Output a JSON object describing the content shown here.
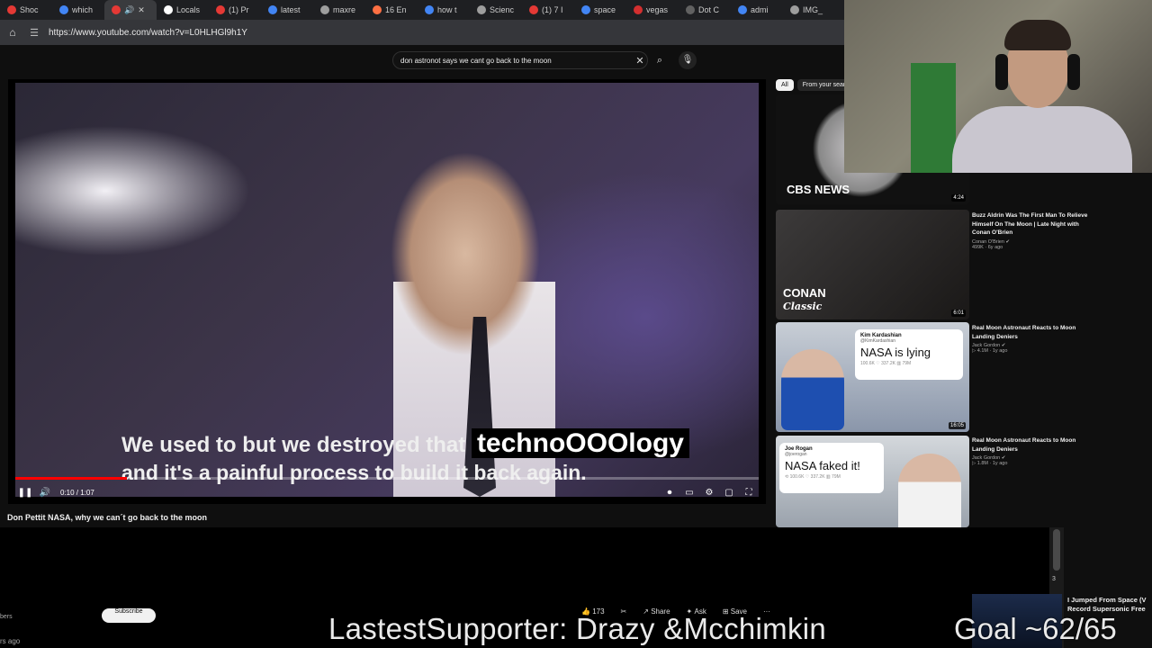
{
  "browser": {
    "tabs": [
      {
        "label": "Shoc",
        "favicon_color": "#e53935",
        "active": false
      },
      {
        "label": "which",
        "favicon_color": "#4285f4",
        "active": false
      },
      {
        "label": "",
        "favicon_color": "#e53935",
        "active": true
      },
      {
        "label": "Locals",
        "favicon_color": "#ffffff",
        "active": false
      },
      {
        "label": "(1) Pr",
        "favicon_color": "#e53935",
        "active": false
      },
      {
        "label": "latest",
        "favicon_color": "#4285f4",
        "active": false
      },
      {
        "label": "maxre",
        "favicon_color": "#9e9e9e",
        "active": false
      },
      {
        "label": "16 En",
        "favicon_color": "#ff7043",
        "active": false
      },
      {
        "label": "how t",
        "favicon_color": "#4285f4",
        "active": false
      },
      {
        "label": "Scienc",
        "favicon_color": "#9e9e9e",
        "active": false
      },
      {
        "label": "(1) 7 I",
        "favicon_color": "#e53935",
        "active": false
      },
      {
        "label": "space",
        "favicon_color": "#4285f4",
        "active": false
      },
      {
        "label": "vegas",
        "favicon_color": "#d32f2f",
        "active": false
      },
      {
        "label": "Dot C",
        "favicon_color": "#616161",
        "active": false
      },
      {
        "label": "admi",
        "favicon_color": "#4285f4",
        "active": false
      },
      {
        "label": "IMG_",
        "favicon_color": "#9e9e9e",
        "active": false
      }
    ],
    "url": "https://www.youtube.com/watch?v=L0HLHGl9h1Y"
  },
  "youtube": {
    "search_query": "don astronot says we cant go back to the moon",
    "player": {
      "subtitle_line1": "We used to but we destroyed that",
      "subtitle_highlight": "technoOOOlogy",
      "subtitle_line2": "and it's a painful process to build it back again.",
      "time": "0:10 / 1:07",
      "progress": 0.15
    },
    "video_title": "Don Pettit NASA, why we can´t go back to the moon",
    "chips": [
      "All",
      "From your sear"
    ],
    "recommended": [
      {
        "brand": "CBS NEWS",
        "duration": "4:24"
      },
      {
        "brand_line1": "CONAN",
        "brand_line2": "Classic",
        "duration": "6:01",
        "title": "Buzz Aldrin Was The First Man To Relieve Himself On The Moon | Late Night with Conan O'Brien",
        "channel": "Conan O'Brien ✔",
        "views": "499K · 6y ago"
      },
      {
        "duration": "16:05",
        "tweet_name": "Kim Kardashian",
        "tweet_handle": "@KimKardashian",
        "tweet_text": "NASA is lying",
        "tweet_stats": "100.6K ♡ 337.2K ▥ 79M",
        "title": "Real Moon Astronaut Reacts to Moon Landing Deniers",
        "channel": "Jack Gordon ✔",
        "views": "▷ 4.1M · 1y ago"
      },
      {
        "tweet_name": "Joe Rogan",
        "tweet_handle": "@joerogan",
        "tweet_text": "NASA faked it!",
        "tweet_stats": "⟲ 100.6K ♡ 337.2K ▥ 79M",
        "title": "Real Moon Astronaut Reacts to Moon Landing Deniers",
        "channel": "Jack Gordon ✔",
        "views": "▷ 1.8M · 1y ago"
      }
    ],
    "lower": {
      "subs_fragment": "bers",
      "ago_fragment": "rs ago",
      "subscribe_label": "Subscribe",
      "actions": [
        "173",
        "",
        "Share",
        "Ask",
        "Save",
        "···"
      ],
      "mini_title": "I Jumped From Space (V Record Supersonic Free",
      "scroll_number": "3"
    }
  },
  "stream_overlay": {
    "latest_supporter": "LastestSupporter: Drazy &Mcchimkin",
    "goal": "Goal ~62/65"
  }
}
